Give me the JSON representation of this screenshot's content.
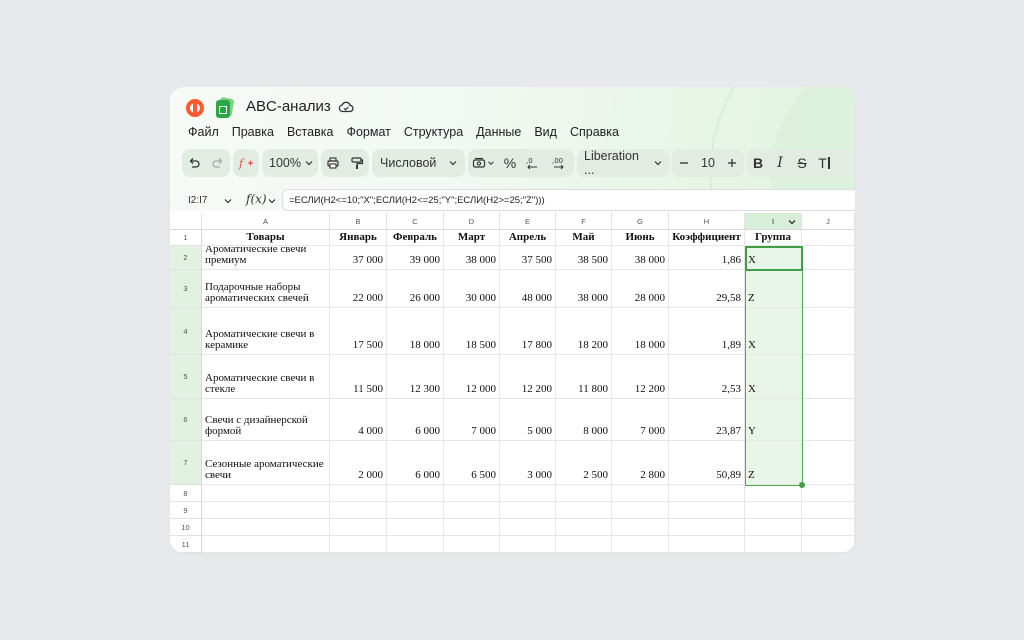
{
  "app": {
    "doc_title": "ABC-анализ"
  },
  "menu": [
    "Файл",
    "Правка",
    "Вставка",
    "Формат",
    "Структура",
    "Данные",
    "Вид",
    "Справка"
  ],
  "toolbar": {
    "zoom": "100%",
    "number_format": "Числовой",
    "percent": "%",
    "font": "Liberation ...",
    "font_size": "10",
    "bold": "B",
    "italic": "I",
    "strike": "S",
    "text_format": "T"
  },
  "formula_bar": {
    "cell_ref": "I2:I7",
    "fx": "f(x)",
    "formula": "=ЕСЛИ(H2<=10;\"X\";ЕСЛИ(H2<=25;\"Y\";ЕСЛИ(H2>=25;\"Z\")))"
  },
  "columns": [
    "A",
    "B",
    "C",
    "D",
    "E",
    "F",
    "G",
    "H",
    "I",
    "J"
  ],
  "row_numbers": [
    "1",
    "2",
    "3",
    "4",
    "5",
    "6",
    "7",
    "8",
    "9",
    "10",
    "11"
  ],
  "headers": [
    "Товары",
    "Январь",
    "Февраль",
    "Март",
    "Апрель",
    "Май",
    "Июнь",
    "Коэффициент",
    "Группа"
  ],
  "rows": [
    [
      "Ароматические свечи премиум",
      "37 000",
      "39 000",
      "38 000",
      "37 500",
      "38 500",
      "38 000",
      "1,86",
      "X"
    ],
    [
      "Подарочные наборы ароматических свечей",
      "22 000",
      "26 000",
      "30 000",
      "48 000",
      "38 000",
      "28 000",
      "29,58",
      "Z"
    ],
    [
      "Ароматические свечи в керамике",
      "17 500",
      "18 000",
      "18 500",
      "17 800",
      "18 200",
      "18 000",
      "1,89",
      "X"
    ],
    [
      "Ароматические свечи в стекле",
      "11 500",
      "12 300",
      "12 000",
      "12 200",
      "11 800",
      "12 200",
      "2,53",
      "X"
    ],
    [
      "Свечи с дизайнерской формой",
      "4 000",
      "6 000",
      "7 000",
      "5 000",
      "8 000",
      "7 000",
      "23,87",
      "Y"
    ],
    [
      "Сезонные ароматические свечи",
      "2 000",
      "6 000",
      "6 500",
      "3 000",
      "2 500",
      "2 800",
      "50,89",
      "Z"
    ]
  ]
}
